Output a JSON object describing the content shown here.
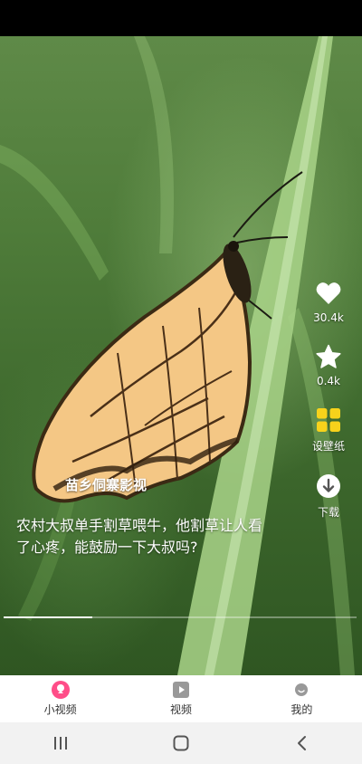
{
  "video": {
    "watermark": "苗乡侗寨影视",
    "caption": "农村大叔单手割草喂牛，他割草让人看了心疼，能鼓励一下大叔吗?",
    "progress_fraction": 0.25
  },
  "actions": {
    "like_count": "30.4k",
    "favorite_count": "0.4k",
    "wallpaper_label": "设壁纸",
    "download_label": "下载"
  },
  "tabs": [
    {
      "label": "小视频",
      "icon": "short-video-icon",
      "active": true
    },
    {
      "label": "视频",
      "icon": "play-icon",
      "active": false
    },
    {
      "label": "我的",
      "icon": "profile-icon",
      "active": false
    }
  ],
  "nav": {
    "recent_icon": "recent-apps-icon",
    "home_icon": "home-icon",
    "back_icon": "back-icon"
  },
  "colors": {
    "tab_active": "#ff4d88",
    "wallpaper_icon": "#f7d21b"
  }
}
